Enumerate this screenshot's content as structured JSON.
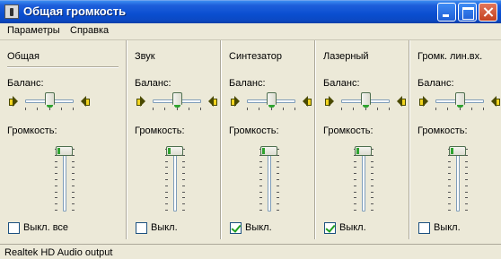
{
  "window": {
    "title": "Общая громкость"
  },
  "menu": {
    "items": [
      "Параметры",
      "Справка"
    ]
  },
  "labels": {
    "balance": "Баланс:",
    "volume": "Громкость:"
  },
  "channels": [
    {
      "name": "Общая",
      "mute_label": "Выкл. все",
      "muted": false,
      "balance": 0.5,
      "volume": 1.0
    },
    {
      "name": "Звук",
      "mute_label": "Выкл.",
      "muted": false,
      "balance": 0.5,
      "volume": 1.0
    },
    {
      "name": "Синтезатор",
      "mute_label": "Выкл.",
      "muted": true,
      "balance": 0.5,
      "volume": 1.0
    },
    {
      "name": "Лазерный",
      "mute_label": "Выкл.",
      "muted": true,
      "balance": 0.5,
      "volume": 1.0
    },
    {
      "name": "Громк. лин.вх.",
      "mute_label": "Выкл.",
      "muted": false,
      "balance": 0.5,
      "volume": 1.0
    }
  ],
  "status": {
    "device": "Realtek HD Audio output"
  },
  "colors": {
    "title_bar": "#0a4ed0",
    "close_button": "#c5421f",
    "thumb_accent": "#2fa32f"
  }
}
